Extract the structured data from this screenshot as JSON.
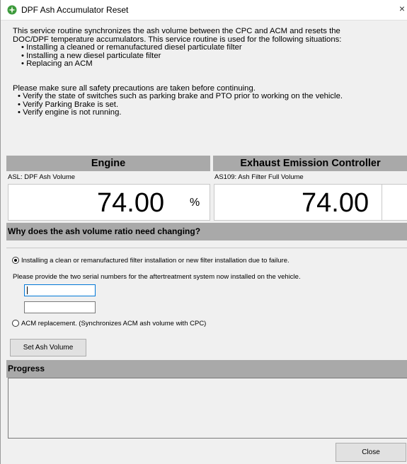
{
  "window": {
    "title": "DPF Ash Accumulator Reset",
    "close_glyph": "×",
    "icon": "app-status-icon"
  },
  "intro": {
    "line1": "This service routine synchronizes the ash volume between the CPC and ACM and resets the",
    "line2": "DOC/DPF temperature accumulators. This service routine is used for the following situations:",
    "bullets": [
      "• Installing a cleaned or remanufactured diesel particulate filter",
      "• Installing a new diesel particulate filter",
      "• Replacing an ACM"
    ],
    "safety": "Please make sure all safety precautions are taken before continuing.",
    "safety_bullets": [
      "• Verify the state of switches such as parking brake and PTO prior to working on the vehicle.",
      "• Verify Parking Brake is set.",
      "• Verify engine is not running."
    ]
  },
  "engine_panel": {
    "header": "Engine",
    "sub_label": "ASL: DPF Ash Volume",
    "value": "74.00",
    "unit": "%"
  },
  "eec_panel": {
    "header": "Exhaust Emission Controller",
    "sub_label": "AS109: Ash Filter Full Volume",
    "value": "74.00"
  },
  "reason_section": {
    "header": "Why does the ash volume ratio need changing?",
    "option1": "Installing a clean or remanufactured filter installation or new filter installation due to failure.",
    "option1_selected": true,
    "serial_prompt": "Please provide the two serial numbers for the aftertreatment system now installed on the vehicle.",
    "serial1_value": "",
    "serial2_value": "",
    "option2": "ACM replacement. (Synchronizes ACM ash volume with CPC)",
    "option2_selected": false,
    "set_button": "Set Ash Volume"
  },
  "progress": {
    "header": "Progress",
    "content": ""
  },
  "footer": {
    "close_button": "Close"
  },
  "colors": {
    "section_header": "#a9a9a9",
    "window_bg": "#f0f0f0",
    "icon_green": "#3c9a3c"
  }
}
